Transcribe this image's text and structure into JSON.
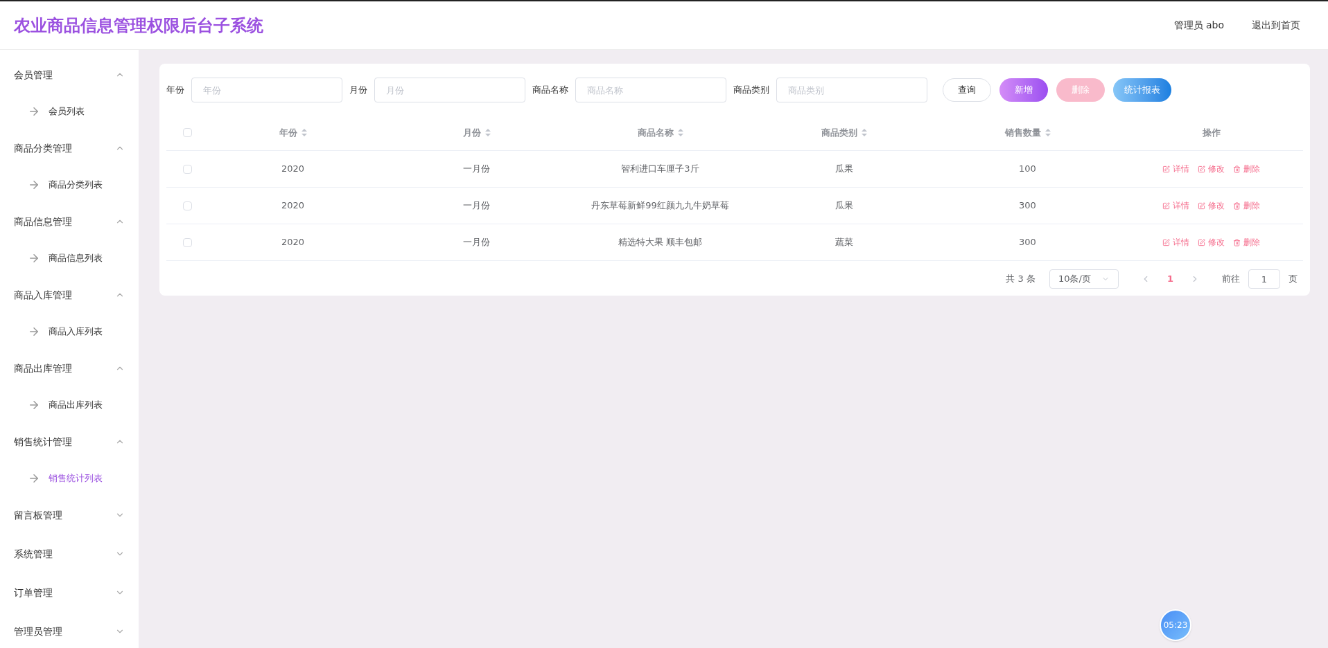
{
  "header": {
    "title": "农业商品信息管理权限后台子系统",
    "user": "管理员 abo",
    "exit_link": "退出到首页"
  },
  "sidebar": {
    "groups": [
      {
        "label": "会员管理",
        "expanded": true,
        "children": [
          {
            "label": "会员列表",
            "selected": false
          }
        ]
      },
      {
        "label": "商品分类管理",
        "expanded": true,
        "children": [
          {
            "label": "商品分类列表",
            "selected": false
          }
        ]
      },
      {
        "label": "商品信息管理",
        "expanded": true,
        "children": [
          {
            "label": "商品信息列表",
            "selected": false
          }
        ]
      },
      {
        "label": "商品入库管理",
        "expanded": true,
        "children": [
          {
            "label": "商品入库列表",
            "selected": false
          }
        ]
      },
      {
        "label": "商品出库管理",
        "expanded": true,
        "children": [
          {
            "label": "商品出库列表",
            "selected": false
          }
        ]
      },
      {
        "label": "销售统计管理",
        "expanded": true,
        "children": [
          {
            "label": "销售统计列表",
            "selected": true
          }
        ]
      },
      {
        "label": "留言板管理",
        "expanded": false
      },
      {
        "label": "系统管理",
        "expanded": false
      },
      {
        "label": "订单管理",
        "expanded": false
      },
      {
        "label": "管理员管理",
        "expanded": false
      }
    ]
  },
  "filters": [
    {
      "label": "年份",
      "placeholder": "年份"
    },
    {
      "label": "月份",
      "placeholder": "月份"
    },
    {
      "label": "商品名称",
      "placeholder": "商品名称"
    },
    {
      "label": "商品类别",
      "placeholder": "商品类别"
    }
  ],
  "buttons": [
    {
      "label": "查询",
      "kind": "outline"
    },
    {
      "label": "新增",
      "kind": "add"
    },
    {
      "label": "删除",
      "kind": "delete",
      "disabled": true
    },
    {
      "label": "统计报表",
      "kind": "report"
    }
  ],
  "table": {
    "all_checked": false,
    "columns": [
      {
        "label": "年份",
        "sortable": true
      },
      {
        "label": "月份",
        "sortable": true
      },
      {
        "label": "商品名称",
        "sortable": true
      },
      {
        "label": "商品类别",
        "sortable": true
      },
      {
        "label": "销售数量",
        "sortable": true
      },
      {
        "label": "操作",
        "sortable": false
      }
    ],
    "rows": [
      {
        "checked": false,
        "cells": [
          "2020",
          "一月份",
          "智利进口车厘子3斤",
          "瓜果",
          "100"
        ],
        "actions": [
          "详情",
          "修改",
          "删除"
        ]
      },
      {
        "checked": false,
        "cells": [
          "2020",
          "一月份",
          "丹东草莓新鲜99红颜九九牛奶草莓",
          "瓜果",
          "300"
        ],
        "actions": [
          "详情",
          "修改",
          "删除"
        ]
      },
      {
        "checked": false,
        "cells": [
          "2020",
          "一月份",
          "精选特大果 顺丰包邮",
          "蔬菜",
          "300"
        ],
        "actions": [
          "详情",
          "修改",
          "删除"
        ]
      }
    ]
  },
  "pagination": {
    "total": "共 3 条",
    "page_size": "10条/页",
    "pages": [
      {
        "label": "1",
        "selected": true
      }
    ],
    "goto_label": "前往",
    "goto_value": "1",
    "page_suffix": "页"
  },
  "timer": "05:23"
}
